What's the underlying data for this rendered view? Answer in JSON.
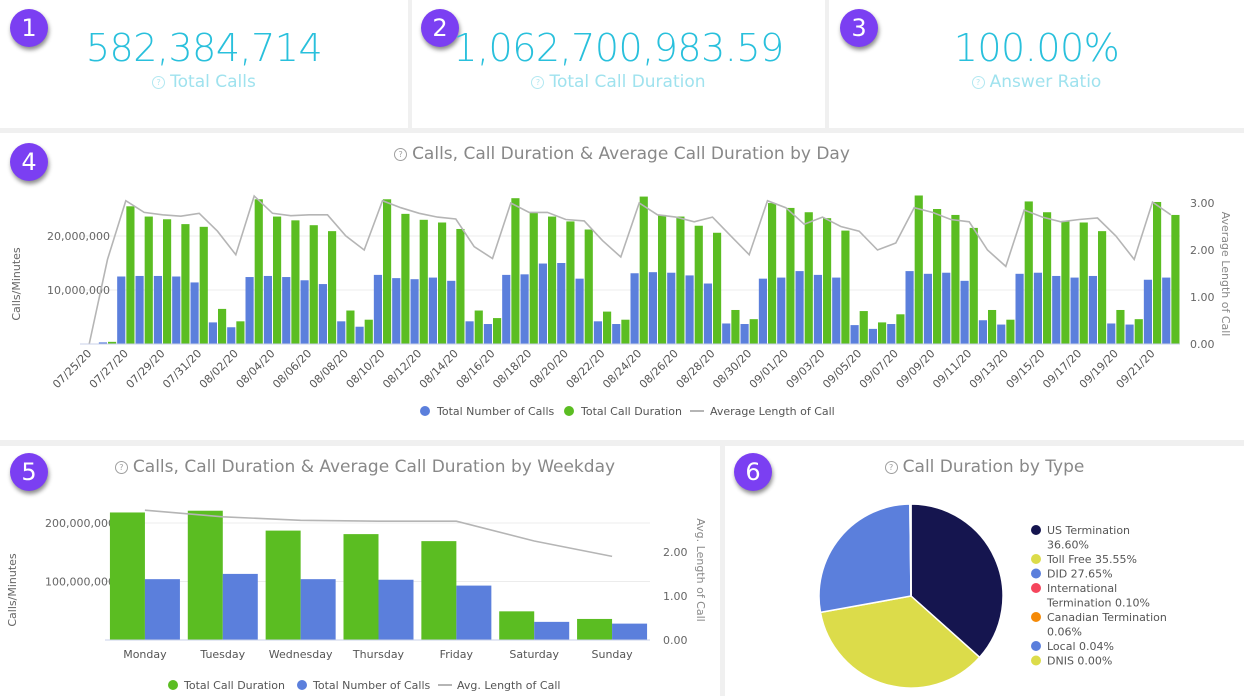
{
  "kpis": [
    {
      "badge": "1",
      "value": "582,384,714",
      "label": "Total Calls"
    },
    {
      "badge": "2",
      "value": "1,062,700,983.59",
      "label": "Total Call Duration"
    },
    {
      "badge": "3",
      "value": "100.00%",
      "label": "Answer Ratio"
    }
  ],
  "panels": {
    "daily": {
      "badge": "4",
      "title": "Calls, Call Duration & Average Call Duration by Day"
    },
    "weekday": {
      "badge": "5",
      "title": "Calls, Call Duration & Average Call Duration by Weekday"
    },
    "type": {
      "badge": "6",
      "title": "Call Duration by Type"
    }
  },
  "colors": {
    "calls": "#5b7fdc",
    "duration": "#5bbd22",
    "avg_line": "#b5b5b5",
    "kpi": "#29c0dc",
    "badge": "#7b3ff2"
  },
  "chart_data": [
    {
      "type": "bar",
      "title": "Calls, Call Duration & Average Call Duration by Day",
      "ylabel": "Calls/Minutes",
      "y2label": "Average Length of Call",
      "ylim": [
        0,
        27000000
      ],
      "y_ticks": [
        "10,000,000",
        "20,000,000"
      ],
      "y2lim": [
        0,
        3.0
      ],
      "y2_ticks": [
        "0.00",
        "1.00",
        "2.00",
        "3.00"
      ],
      "x": [
        "07/25/20",
        "07/26/20",
        "07/27/20",
        "07/28/20",
        "07/29/20",
        "07/30/20",
        "07/31/20",
        "08/01/20",
        "08/02/20",
        "08/03/20",
        "08/04/20",
        "08/05/20",
        "08/06/20",
        "08/07/20",
        "08/08/20",
        "08/09/20",
        "08/10/20",
        "08/11/20",
        "08/12/20",
        "08/13/20",
        "08/14/20",
        "08/15/20",
        "08/16/20",
        "08/17/20",
        "08/18/20",
        "08/19/20",
        "08/20/20",
        "08/21/20",
        "08/22/20",
        "08/23/20",
        "08/24/20",
        "08/25/20",
        "08/26/20",
        "08/27/20",
        "08/28/20",
        "08/29/20",
        "08/30/20",
        "08/31/20",
        "09/01/20",
        "09/02/20",
        "09/03/20",
        "09/04/20",
        "09/05/20",
        "09/06/20",
        "09/07/20",
        "09/08/20",
        "09/09/20",
        "09/10/20",
        "09/11/20",
        "09/12/20",
        "09/13/20",
        "09/14/20",
        "09/15/20",
        "09/16/20",
        "09/17/20",
        "09/18/20",
        "09/19/20",
        "09/20/20",
        "09/21/20",
        "09/22/20"
      ],
      "x_tick_labels": [
        "07/25/20",
        "07/27/20",
        "07/29/20",
        "07/31/20",
        "08/02/20",
        "08/04/20",
        "08/06/20",
        "08/08/20",
        "08/10/20",
        "08/12/20",
        "08/14/20",
        "08/16/20",
        "08/18/20",
        "08/20/20",
        "08/22/20",
        "08/24/20",
        "08/26/20",
        "08/28/20",
        "08/30/20",
        "09/01/20",
        "09/03/20",
        "09/05/20",
        "09/07/20",
        "09/09/20",
        "09/11/20",
        "09/13/20",
        "09/15/20",
        "09/17/20",
        "09/19/20",
        "09/21/20"
      ],
      "legend": "bottom",
      "grid": true,
      "series": [
        {
          "name": "Total Number of Calls",
          "kind": "bar",
          "axis": "left",
          "values": [
            0,
            300000,
            12500000,
            12600000,
            12600000,
            12500000,
            11400000,
            4000000,
            3100000,
            12400000,
            12600000,
            12400000,
            11800000,
            11100000,
            4200000,
            3200000,
            12800000,
            12200000,
            12000000,
            12300000,
            11700000,
            4200000,
            3700000,
            12800000,
            12900000,
            14900000,
            15000000,
            12100000,
            4200000,
            3700000,
            13100000,
            13300000,
            13200000,
            12700000,
            11200000,
            3800000,
            3700000,
            12100000,
            12300000,
            13500000,
            12800000,
            12300000,
            3500000,
            2800000,
            3700000,
            13500000,
            13000000,
            13200000,
            11700000,
            4400000,
            3600000,
            13000000,
            13200000,
            12600000,
            12300000,
            12600000,
            3800000,
            3600000,
            11900000,
            12300000
          ]
        },
        {
          "name": "Total Call Duration",
          "kind": "bar",
          "axis": "left",
          "values": [
            0,
            400000,
            25500000,
            23600000,
            23100000,
            22200000,
            21700000,
            6500000,
            4200000,
            26800000,
            23600000,
            22900000,
            22000000,
            20900000,
            6200000,
            4500000,
            26800000,
            24100000,
            23000000,
            22500000,
            21300000,
            6200000,
            4800000,
            27000000,
            24400000,
            23600000,
            22700000,
            21200000,
            6000000,
            4500000,
            27300000,
            23900000,
            23600000,
            21900000,
            20600000,
            6300000,
            4600000,
            26100000,
            25200000,
            24400000,
            23300000,
            21000000,
            6100000,
            4000000,
            5500000,
            27500000,
            25000000,
            23900000,
            21500000,
            6300000,
            4500000,
            26400000,
            24400000,
            22800000,
            22500000,
            20900000,
            6300000,
            4600000,
            26300000,
            23900000
          ]
        },
        {
          "name": "Average Length of Call",
          "kind": "line",
          "axis": "right",
          "values": [
            0,
            1.8,
            3.05,
            2.8,
            2.75,
            2.72,
            2.78,
            2.4,
            1.9,
            3.15,
            2.78,
            2.73,
            2.75,
            2.75,
            2.3,
            2.0,
            3.05,
            2.9,
            2.78,
            2.7,
            2.66,
            2.07,
            1.82,
            3.0,
            2.8,
            2.8,
            2.65,
            2.62,
            2.2,
            1.85,
            3.0,
            2.75,
            2.7,
            2.6,
            2.7,
            2.3,
            1.9,
            3.05,
            2.9,
            2.55,
            2.7,
            2.5,
            2.4,
            2.0,
            2.15,
            2.9,
            2.8,
            2.65,
            2.6,
            2.0,
            1.65,
            2.85,
            2.7,
            2.6,
            2.65,
            2.68,
            2.3,
            1.8,
            3.02,
            2.75
          ]
        }
      ]
    },
    {
      "type": "bar",
      "title": "Calls, Call Duration & Average Call Duration by Weekday",
      "ylabel": "Calls/Minutes",
      "y2label": "Avg. Length of Call",
      "ylim": [
        0,
        225000000
      ],
      "y_ticks": [
        "100,000,000",
        "200,000,000"
      ],
      "y2lim": [
        0,
        3.0
      ],
      "y2_ticks": [
        "0.00",
        "1.00",
        "2.00"
      ],
      "categories": [
        "Monday",
        "Tuesday",
        "Wednesday",
        "Thursday",
        "Friday",
        "Saturday",
        "Sunday"
      ],
      "legend": "bottom",
      "grid": true,
      "series": [
        {
          "name": "Total Call Duration",
          "kind": "bar",
          "axis": "left",
          "values": [
            218000000,
            221000000,
            187000000,
            181000000,
            169000000,
            49000000,
            36000000
          ]
        },
        {
          "name": "Total Number of Calls",
          "kind": "bar",
          "axis": "left",
          "values": [
            104000000,
            113000000,
            104000000,
            103000000,
            93000000,
            31000000,
            28000000
          ]
        },
        {
          "name": "Avg. Length of Call",
          "kind": "line",
          "axis": "right",
          "values": [
            2.95,
            2.8,
            2.72,
            2.7,
            2.7,
            2.25,
            1.9
          ]
        }
      ]
    },
    {
      "type": "pie",
      "title": "Call Duration by Type",
      "legend": "right",
      "slices": [
        {
          "label": "US Termination",
          "value": 36.6,
          "text": "36.60%",
          "color": "#15154f"
        },
        {
          "label": "Toll Free",
          "value": 35.55,
          "text": "35.55%",
          "color": "#dcdc4a"
        },
        {
          "label": "DID",
          "value": 27.65,
          "text": "27.65%",
          "color": "#5b7fdc"
        },
        {
          "label": "International Termination",
          "value": 0.1,
          "text": "0.10%",
          "color": "#f5455c"
        },
        {
          "label": "Canadian Termination",
          "value": 0.06,
          "text": "0.06%",
          "color": "#f58a07"
        },
        {
          "label": "Local",
          "value": 0.04,
          "text": "0.04%",
          "color": "#5b7fdc"
        },
        {
          "label": "DNIS",
          "value": 0.0,
          "text": "0.00%",
          "color": "#dcdc4a"
        }
      ]
    }
  ]
}
